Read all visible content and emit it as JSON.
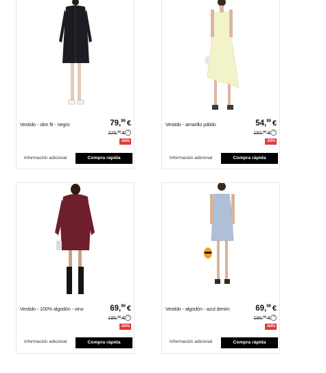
{
  "products": [
    {
      "name": "Vestido - slim fit - negro",
      "price_int": "79",
      "price_dec": "99",
      "currency": "€",
      "old_int": "225",
      "old_dec": "00",
      "old_currency": "€",
      "discount": "-64%",
      "info_label": "Información adicional",
      "quick_buy_label": "Compra rápida"
    },
    {
      "name": "Vestido - amarillo pálido",
      "price_int": "54",
      "price_dec": "99",
      "currency": "€",
      "old_int": "150",
      "old_dec": "00",
      "old_currency": "€",
      "discount": "-63%",
      "info_label": "Información adicional",
      "quick_buy_label": "Compra rápida"
    },
    {
      "name": "Vestido - 100% algodón - vino",
      "price_int": "69",
      "price_dec": "99",
      "currency": "€",
      "old_int": "195",
      "old_dec": "00",
      "old_currency": "€",
      "discount": "-64%",
      "info_label": "Información adicional",
      "quick_buy_label": "Compra rápida"
    },
    {
      "name": "Vestido - algodón - azul denim",
      "price_int": "69",
      "price_dec": "99",
      "currency": "€",
      "old_int": "195",
      "old_dec": "00",
      "old_currency": "€",
      "discount": "-64%",
      "info_label": "Información adicional",
      "quick_buy_label": "Compra rápida"
    }
  ],
  "colors": {
    "discount_badge": "#e03a3a",
    "quick_buy_bg": "#000000",
    "card_border": "#e6e6e6"
  }
}
